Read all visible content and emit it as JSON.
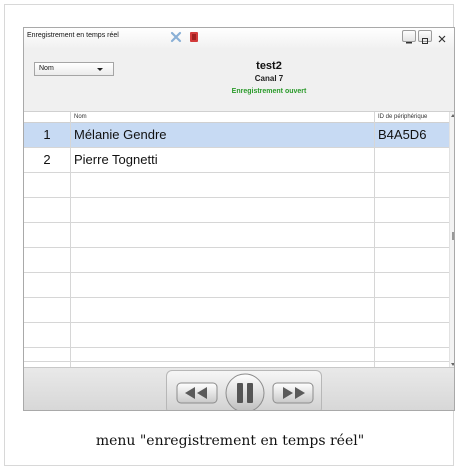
{
  "window": {
    "title": "Enregistrement en temps réel"
  },
  "selector": {
    "value": "Nom"
  },
  "recording": {
    "name": "test2",
    "channel": "Canal 7",
    "status": "Enregistrement ouvert",
    "status_color": "#2a9a2a"
  },
  "table": {
    "columns": [
      "",
      "Nom",
      "ID de périphérique"
    ],
    "rows": [
      {
        "index": "1",
        "name": "Mélanie Gendre",
        "device_id": "B4A5D6",
        "selected": true
      },
      {
        "index": "2",
        "name": "Pierre Tognetti",
        "device_id": "",
        "selected": false
      }
    ],
    "selected_color": "#c7daf3"
  },
  "controls": {
    "icons": [
      "rewind-icon",
      "pause-icon",
      "fast-forward-icon"
    ]
  },
  "caption": "menu \"enregistrement en temps réel\""
}
